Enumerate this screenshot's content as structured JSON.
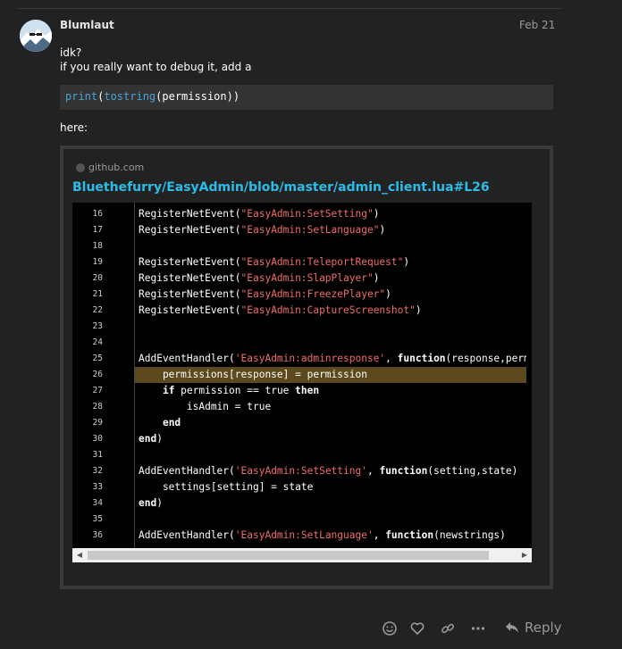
{
  "post": {
    "username": "Blumlaut",
    "date": "Feb 21",
    "line1": "idk?",
    "line2": "if you really want to debug it, add a",
    "inline_code": {
      "fn1": "print",
      "paren1": "(",
      "fn2": "tostring",
      "arg": "(permission))"
    },
    "line3": "here:"
  },
  "onebox": {
    "source": "github.com",
    "link": "Bluethefurry/EasyAdmin/blob/master/admin_client.lua#L26",
    "code_lines": [
      {
        "num": "16",
        "parts": [
          [
            "t",
            "RegisterNetEvent("
          ],
          [
            "s",
            "\"EasyAdmin:SetSetting\""
          ],
          [
            "t",
            ")"
          ]
        ]
      },
      {
        "num": "17",
        "parts": [
          [
            "t",
            "RegisterNetEvent("
          ],
          [
            "s",
            "\"EasyAdmin:SetLanguage\""
          ],
          [
            "t",
            ")"
          ]
        ]
      },
      {
        "num": "18",
        "parts": []
      },
      {
        "num": "19",
        "parts": [
          [
            "t",
            "RegisterNetEvent("
          ],
          [
            "s",
            "\"EasyAdmin:TeleportRequest\""
          ],
          [
            "t",
            ")"
          ]
        ]
      },
      {
        "num": "20",
        "parts": [
          [
            "t",
            "RegisterNetEvent("
          ],
          [
            "s",
            "\"EasyAdmin:SlapPlayer\""
          ],
          [
            "t",
            ")"
          ]
        ]
      },
      {
        "num": "21",
        "parts": [
          [
            "t",
            "RegisterNetEvent("
          ],
          [
            "s",
            "\"EasyAdmin:FreezePlayer\""
          ],
          [
            "t",
            ")"
          ]
        ]
      },
      {
        "num": "22",
        "parts": [
          [
            "t",
            "RegisterNetEvent("
          ],
          [
            "s",
            "\"EasyAdmin:CaptureScreenshot\""
          ],
          [
            "t",
            ")"
          ]
        ]
      },
      {
        "num": "23",
        "parts": []
      },
      {
        "num": "24",
        "parts": []
      },
      {
        "num": "25",
        "parts": [
          [
            "t",
            "AddEventHandler("
          ],
          [
            "s",
            "'EasyAdmin:adminresponse'"
          ],
          [
            "t",
            ", "
          ],
          [
            "k",
            "function"
          ],
          [
            "t",
            "(response,permis"
          ]
        ]
      },
      {
        "num": "26",
        "highlight": true,
        "parts": [
          [
            "t",
            "    permissions[response] = permission"
          ]
        ]
      },
      {
        "num": "27",
        "parts": [
          [
            "t",
            "    "
          ],
          [
            "k",
            "if"
          ],
          [
            "t",
            " permission == true "
          ],
          [
            "k",
            "then"
          ]
        ]
      },
      {
        "num": "28",
        "parts": [
          [
            "t",
            "        isAdmin = true"
          ]
        ]
      },
      {
        "num": "29",
        "parts": [
          [
            "t",
            "    "
          ],
          [
            "k",
            "end"
          ]
        ]
      },
      {
        "num": "30",
        "parts": [
          [
            "k",
            "end"
          ],
          [
            "t",
            ")"
          ]
        ]
      },
      {
        "num": "31",
        "parts": []
      },
      {
        "num": "32",
        "parts": [
          [
            "t",
            "AddEventHandler("
          ],
          [
            "s",
            "'EasyAdmin:SetSetting'"
          ],
          [
            "t",
            ", "
          ],
          [
            "k",
            "function"
          ],
          [
            "t",
            "(setting,state)"
          ]
        ]
      },
      {
        "num": "33",
        "parts": [
          [
            "t",
            "    settings[setting] = state"
          ]
        ]
      },
      {
        "num": "34",
        "parts": [
          [
            "k",
            "end"
          ],
          [
            "t",
            ")"
          ]
        ]
      },
      {
        "num": "35",
        "parts": []
      },
      {
        "num": "36",
        "parts": [
          [
            "t",
            "AddEventHandler("
          ],
          [
            "s",
            "'EasyAdmin:SetLanguage'"
          ],
          [
            "t",
            ", "
          ],
          [
            "k",
            "function"
          ],
          [
            "t",
            "(newstrings)"
          ]
        ]
      }
    ]
  },
  "actions": {
    "icons": [
      "smile-icon",
      "heart-icon",
      "link-icon",
      "more-icon"
    ],
    "reply_label": "Reply"
  },
  "colors": {
    "background": "#222222",
    "link": "#2bbdea",
    "string": "#f06b6b",
    "highlight": "#5c4a1e"
  }
}
